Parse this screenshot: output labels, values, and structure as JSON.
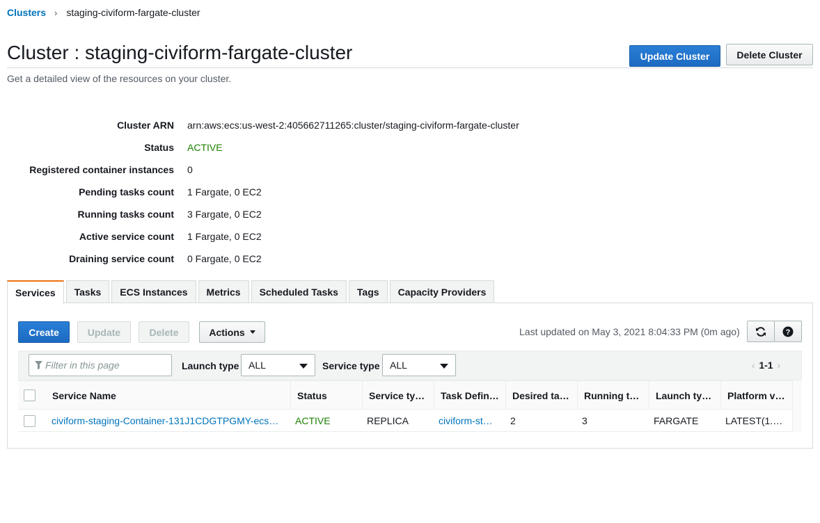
{
  "breadcrumb": {
    "root": "Clusters",
    "separator": "›",
    "current": "staging-civiform-fargate-cluster"
  },
  "header": {
    "title": "Cluster : staging-civiform-fargate-cluster",
    "subtitle": "Get a detailed view of the resources on your cluster.",
    "update_button": "Update Cluster",
    "delete_button": "Delete Cluster"
  },
  "details": [
    {
      "label": "Cluster ARN",
      "value": "arn:aws:ecs:us-west-2:405662711265:cluster/staging-civiform-fargate-cluster"
    },
    {
      "label": "Status",
      "value": "ACTIVE"
    },
    {
      "label": "Registered container instances",
      "value": "0"
    },
    {
      "label": "Pending tasks count",
      "value": "1 Fargate, 0 EC2"
    },
    {
      "label": "Running tasks count",
      "value": "3 Fargate, 0 EC2"
    },
    {
      "label": "Active service count",
      "value": "1 Fargate, 0 EC2"
    },
    {
      "label": "Draining service count",
      "value": "0 Fargate, 0 EC2"
    }
  ],
  "tabs": [
    "Services",
    "Tasks",
    "ECS Instances",
    "Metrics",
    "Scheduled Tasks",
    "Tags",
    "Capacity Providers"
  ],
  "active_tab": "Services",
  "toolbar": {
    "create": "Create",
    "update": "Update",
    "delete": "Delete",
    "actions": "Actions",
    "last_updated": "Last updated on May 3, 2021 8:04:33 PM (0m ago)",
    "refresh_icon": "refresh-icon",
    "help_icon": "help-icon"
  },
  "filters": {
    "search_placeholder": "Filter in this page",
    "launch_type_label": "Launch type",
    "launch_type_value": "ALL",
    "service_type_label": "Service type",
    "service_type_value": "ALL",
    "page_range": "1-1",
    "prev_icon": "chevron-left-icon",
    "next_icon": "chevron-right-icon"
  },
  "table": {
    "columns": [
      "Service Name",
      "Status",
      "Service ty…",
      "Task Defin…",
      "Desired ta…",
      "Running t…",
      "Launch ty…",
      "Platform v…"
    ],
    "rows": [
      {
        "service_name": "civiform-staging-Container-131J1CDGTPGMY-ecs…",
        "status": "ACTIVE",
        "service_type": "REPLICA",
        "task_definition": "civiform-st…",
        "desired_tasks": "2",
        "running_tasks": "3",
        "launch_type": "FARGATE",
        "platform_version": "LATEST(1.…"
      }
    ]
  },
  "colors": {
    "link": "#0073bb",
    "active_status": "#1d8102",
    "primary_button": "#1c6ac2",
    "tab_accent": "#ec7211"
  }
}
